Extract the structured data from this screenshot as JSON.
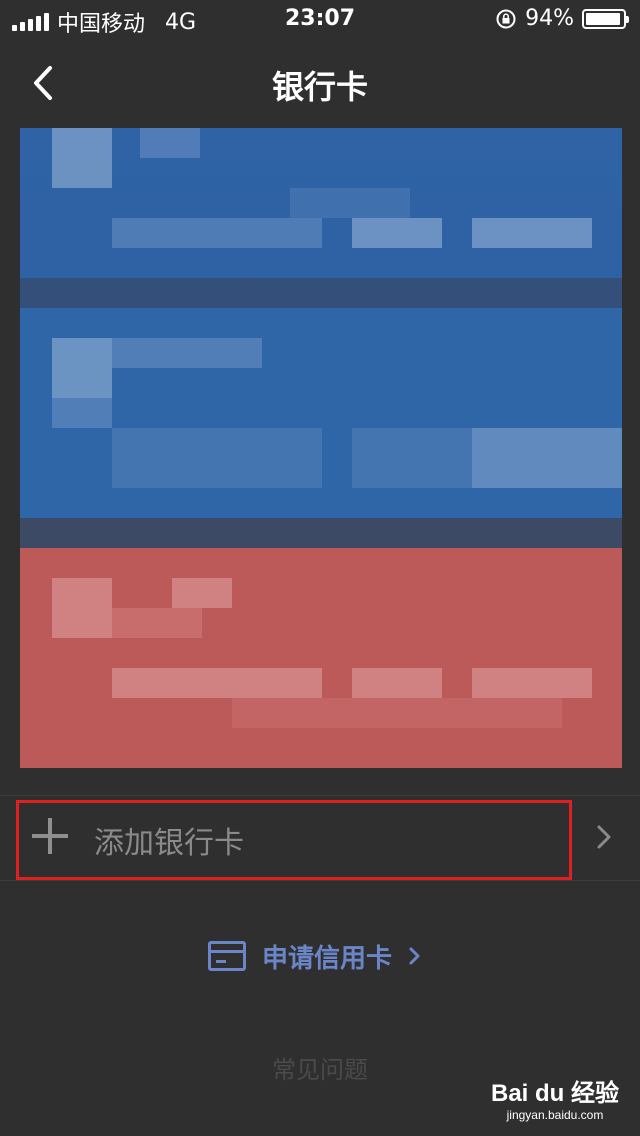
{
  "status": {
    "carrier": "中国移动",
    "network": "4G",
    "time": "23:07",
    "battery": "94%",
    "battery_level": 0.94
  },
  "nav": {
    "title": "银行卡"
  },
  "add_card": {
    "label": "添加银行卡"
  },
  "apply_credit": {
    "label": "申请信用卡"
  },
  "faq": {
    "label": "常见问题"
  },
  "watermark": {
    "brand": "Bai du 经验",
    "url": "jingyan.baidu.com"
  },
  "colors": {
    "background": "#2f2f2f",
    "card_blue": "#2f66a7",
    "card_red": "#bc5a5a",
    "link": "#6b86c8",
    "highlight": "#e02020"
  }
}
